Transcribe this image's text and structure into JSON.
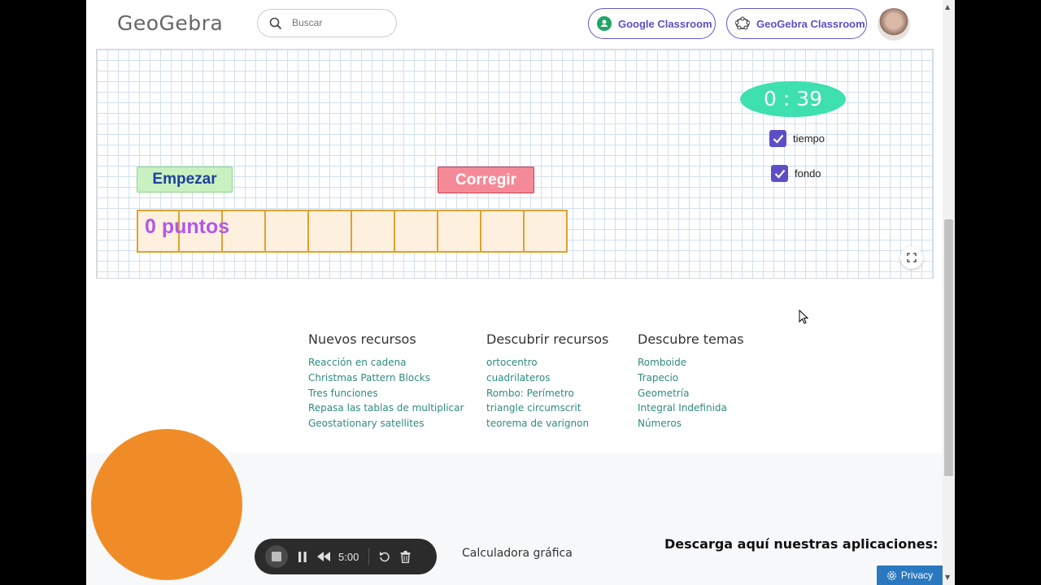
{
  "header": {
    "logo": "GeoGebra",
    "search_placeholder": "Buscar",
    "google_classroom": "Google Classroom",
    "geogebra_classroom": "GeoGebra Classroom"
  },
  "applet": {
    "timer": "0 : 39",
    "checkbox_tiempo": "tiempo",
    "checkbox_fondo": "fondo",
    "start_button": "Empezar",
    "check_button": "Corregir",
    "points": "0 puntos",
    "cell_count": 10
  },
  "resources": {
    "nuevos": {
      "title": "Nuevos recursos",
      "items": [
        "Reacción en cadena",
        "Christmas Pattern Blocks",
        "Tres funciones",
        "Repasa las tablas de multiplicar",
        "Geostationary satellites"
      ]
    },
    "descubrir": {
      "title": "Descubrir recursos",
      "items": [
        "ortocentro",
        "cuadrilateros",
        "Rombo: Perímetro",
        "triangle circumscrit",
        "teorema de varignon"
      ]
    },
    "temas": {
      "title": "Descubre temas",
      "items": [
        "Romboide",
        "Trapecio",
        "Geometría",
        "Integral Indefinida",
        "Números"
      ]
    }
  },
  "footer": {
    "calculadora": "Calculadora gráfica",
    "descarga": "Descarga aquí nuestras aplicaciones:",
    "privacy": "Privacy"
  },
  "recorder": {
    "time": "5:00"
  },
  "colors": {
    "accent": "#5c4fc5",
    "timer": "#3ee0b0",
    "link": "#2e8b80",
    "orange_circle": "#f08c27"
  }
}
